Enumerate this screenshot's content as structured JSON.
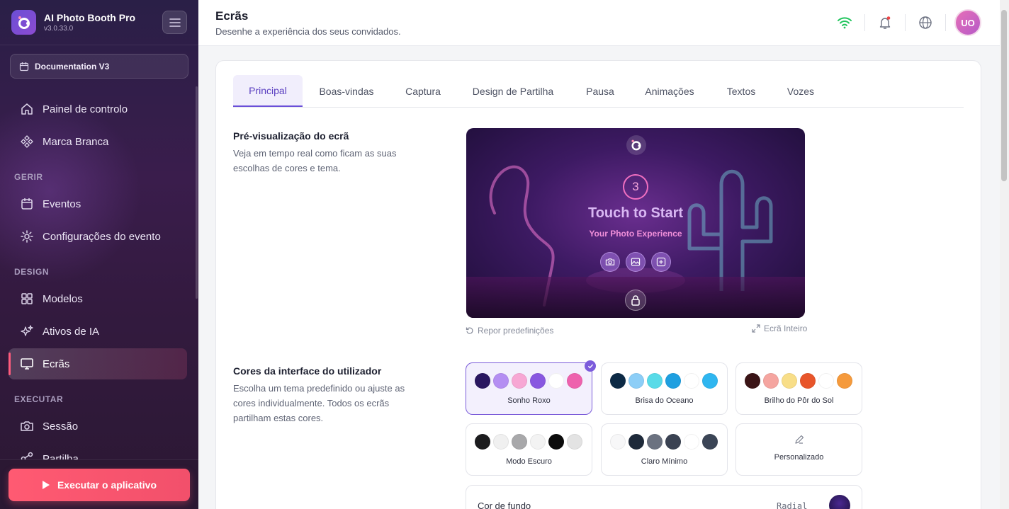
{
  "app": {
    "name": "AI Photo Booth Pro",
    "version": "v3.0.33.0"
  },
  "sidebar": {
    "doc_button": "Documentation V3",
    "items": [
      {
        "label": "Painel de controlo",
        "icon": "home-icon"
      },
      {
        "label": "Marca Branca",
        "icon": "diamond-icon"
      },
      {
        "label": "Eventos",
        "icon": "calendar-icon"
      },
      {
        "label": "Configurações do evento",
        "icon": "gear-icon"
      },
      {
        "label": "Modelos",
        "icon": "grid-icon"
      },
      {
        "label": "Ativos de IA",
        "icon": "sparkles-icon"
      },
      {
        "label": "Ecrãs",
        "icon": "monitor-icon"
      },
      {
        "label": "Sessão",
        "icon": "camera-icon"
      },
      {
        "label": "Partilha",
        "icon": "share-icon"
      }
    ],
    "sections": [
      "GERIR",
      "DESIGN",
      "EXECUTAR"
    ],
    "active_item": "Ecrãs",
    "run_button": "Executar o aplicativo"
  },
  "header": {
    "title": "Ecrãs",
    "subtitle": "Desenhe a experiência dos seus convidados.",
    "avatar_initials": "UO"
  },
  "tabs": [
    "Principal",
    "Boas-vindas",
    "Captura",
    "Design de Partilha",
    "Pausa",
    "Animações",
    "Textos",
    "Vozes"
  ],
  "active_tab": "Principal",
  "preview_section": {
    "title": "Pré-visualização do ecrã",
    "description": "Veja em tempo real como ficam as suas escolhas de cores e tema.",
    "countdown": "3",
    "screen_title": "Touch to Start",
    "screen_subtitle": "Your Photo Experience",
    "reset_label": "Repor predefinições",
    "fullscreen_label": "Ecrã Inteiro"
  },
  "colors_section": {
    "title": "Cores da interface do utilizador",
    "description": "Escolha um tema predefinido ou ajuste as cores individualmente. Todos os ecrãs partilham estas cores.",
    "themes": [
      {
        "name": "Sonho Roxo",
        "selected": true,
        "colors": [
          "#2a1760",
          "#b48ef2",
          "#f7a7d4",
          "#8857e0",
          "#ffffff",
          "#ee62ad"
        ]
      },
      {
        "name": "Brisa do Oceano",
        "selected": false,
        "colors": [
          "#0d2a45",
          "#8ccef7",
          "#58dbe8",
          "#1e9fe0",
          "#ffffff",
          "#2fb6f0"
        ]
      },
      {
        "name": "Brilho do Pôr do Sol",
        "selected": false,
        "colors": [
          "#3a1416",
          "#f5a5a0",
          "#f8de88",
          "#e8552a",
          "#ffffff",
          "#f59a3c"
        ]
      },
      {
        "name": "Modo Escuro",
        "selected": false,
        "colors": [
          "#1c1c1e",
          "#f0f0f0",
          "#a8a8aa",
          "#f3f3f3",
          "#0b0b0b",
          "#e3e3e3"
        ]
      },
      {
        "name": "Claro Mínimo",
        "selected": false,
        "colors": [
          "#f7f7f8",
          "#1e2a3a",
          "#6b7280",
          "#3a4252",
          "#ffffff",
          "#3b4556"
        ]
      },
      {
        "name": "Personalizado",
        "selected": false,
        "colors": []
      }
    ],
    "background": {
      "label": "Cor de fundo",
      "mode": "Radial"
    }
  },
  "accent_color": "#6a4fd8"
}
